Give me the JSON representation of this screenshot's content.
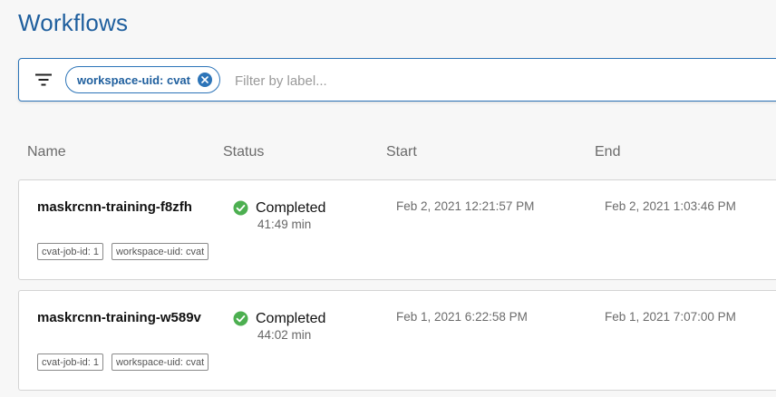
{
  "page_title": "Workflows",
  "filter": {
    "chip_label": "workspace-uid: cvat",
    "placeholder": "Filter by label..."
  },
  "columns": {
    "name": "Name",
    "status": "Status",
    "start": "Start",
    "end": "End"
  },
  "colors": {
    "accent": "#2c74b8",
    "title": "#1f5f9e",
    "success": "#4caf50"
  },
  "workflows": [
    {
      "name": "maskrcnn-training-f8zfh",
      "status": "Completed",
      "status_icon": "check-circle-icon",
      "duration": "41:49 min",
      "start": "Feb 2, 2021 12:21:57 PM",
      "end": "Feb 2, 2021 1:03:46 PM",
      "labels": [
        "cvat-job-id: 1",
        "workspace-uid: cvat"
      ]
    },
    {
      "name": "maskrcnn-training-w589v",
      "status": "Completed",
      "status_icon": "check-circle-icon",
      "duration": "44:02 min",
      "start": "Feb 1, 2021 6:22:58 PM",
      "end": "Feb 1, 2021 7:07:00 PM",
      "labels": [
        "cvat-job-id: 1",
        "workspace-uid: cvat"
      ]
    }
  ]
}
